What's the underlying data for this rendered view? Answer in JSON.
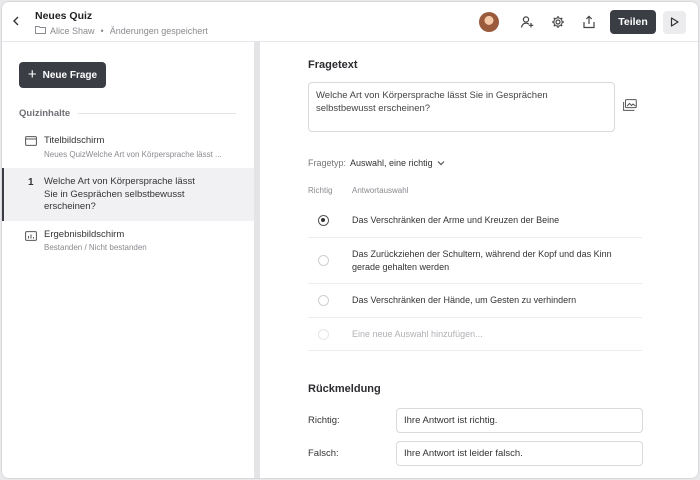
{
  "header": {
    "title": "Neues Quiz",
    "author": "Alice Shaw",
    "separator": "•",
    "status": "Änderungen gespeichert",
    "share_label": "Teilen"
  },
  "sidebar": {
    "new_question_label": "Neue Frage",
    "section_label": "Quizinhalte",
    "items": [
      {
        "label": "Titelbildschirm",
        "desc": "Neues QuizWelche Art von Körpersprache lässt ..."
      },
      {
        "number": "1",
        "label": "Welche Art von Körpersprache lässt Sie in Gesprächen selbstbewusst erscheinen?"
      },
      {
        "label": "Ergebnisbildschirm",
        "desc": "Bestanden / Nicht bestanden"
      }
    ]
  },
  "question": {
    "heading": "Fragetext",
    "text": "Welche Art von Körpersprache lässt Sie in Gesprächen selbstbewusst erscheinen?",
    "type_label": "Fragetyp:",
    "type_value": "Auswahl, eine richtig",
    "col_correct": "Richtig",
    "col_answers": "Antwortauswahl",
    "answers": [
      {
        "text": "Das Verschränken der Arme und Kreuzen der Beine",
        "correct": true
      },
      {
        "text": "Das Zurückziehen der Schultern, während der Kopf und das Kinn gerade gehalten werden",
        "correct": false
      },
      {
        "text": "Das Verschränken der Hände, um Gesten zu verhindern",
        "correct": false
      }
    ],
    "add_answer_placeholder": "Eine neue Auswahl hinzufügen..."
  },
  "feedback": {
    "heading": "Rückmeldung",
    "correct_label": "Richtig:",
    "correct_value": "Ihre Antwort ist richtig.",
    "wrong_label": "Falsch:",
    "wrong_value": "Ihre Antwort ist leider falsch."
  },
  "icons": {
    "back": "chevron-left-icon",
    "folder": "folder-icon",
    "add_user": "add-user-icon",
    "settings": "gear-icon",
    "export": "share-upload-icon",
    "play": "play-icon",
    "title_screen": "window-icon",
    "result_screen": "chart-icon",
    "media": "image-icon",
    "dropdown": "chevron-down-icon"
  },
  "colors": {
    "primary_button": "#3a3d44",
    "active_item_bg": "#f1f1f3"
  }
}
